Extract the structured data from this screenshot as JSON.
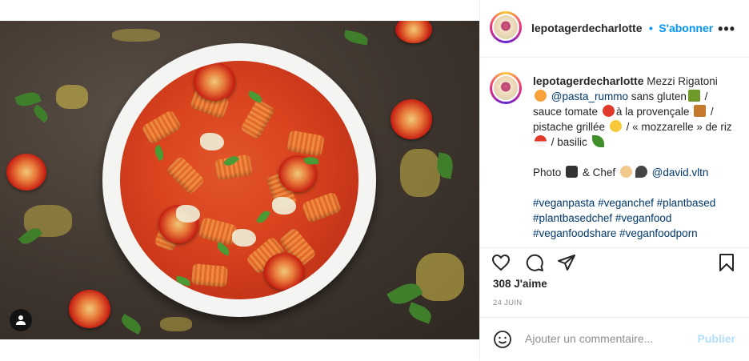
{
  "post": {
    "username": "lepotagerdecharlotte",
    "follow_separator": "•",
    "follow_label": "S'abonner",
    "more_icon": "more-dots-icon"
  },
  "caption": {
    "username": "lepotagerdecharlotte",
    "line_title": "Mezzi Rigatoni",
    "mention_1": "@pasta_rummo",
    "text_1": "sans gluten",
    "sep_1": "/",
    "text_2": "sauce tomate",
    "text_3": "à la provençale",
    "sep_2": "/",
    "text_4": "pistache grillée",
    "text_5": "/ « mozzarelle » de riz",
    "text_6": "/ basilic",
    "photo_label": "Photo",
    "chef_label": "& Chef",
    "mention_2": "@david.vltn",
    "hashtags": [
      "#veganpasta",
      "#veganchef",
      "#plantbased",
      "#plantbasedchef",
      "#veganfood",
      "#veganfoodshare",
      "#veganfoodporn"
    ]
  },
  "stats": {
    "likes": "308 J'aime",
    "date": "24 JUIN"
  },
  "comment": {
    "placeholder": "Ajouter un commentaire...",
    "publish_label": "Publier"
  },
  "colors": {
    "link_blue": "#0095f6",
    "mention_blue": "#00376b",
    "publish_disabled": "#b2dffc"
  }
}
